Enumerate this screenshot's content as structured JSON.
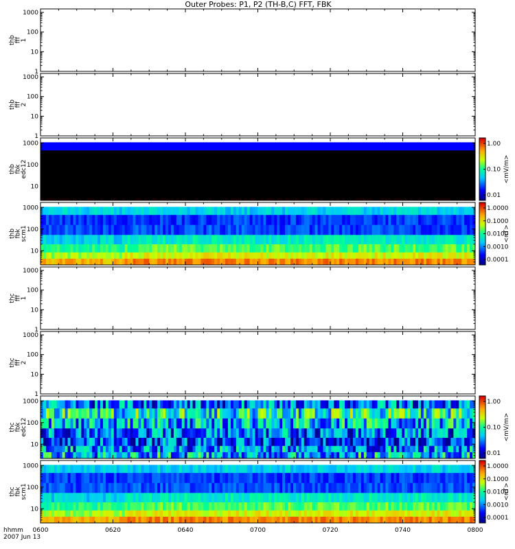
{
  "title": "Outer Probes: P1, P2 (TH-B,C) FFT, FBK",
  "x_axis": {
    "label_line1": "hhmm",
    "label_line2": "2007 Jun 13",
    "tick_labels": [
      "0600",
      "0620",
      "0640",
      "0700",
      "0720",
      "0740",
      "0800"
    ]
  },
  "chart_data": [
    {
      "type": "heatmap",
      "probe": "thb",
      "label_lines": [
        "thb",
        "fff",
        "1"
      ],
      "y_ticks": [
        "1000",
        "100",
        "10",
        "1"
      ],
      "empty": true
    },
    {
      "type": "heatmap",
      "probe": "thb",
      "label_lines": [
        "thb",
        "fff",
        "2"
      ],
      "y_ticks": [
        "1000",
        "100",
        "10",
        "1"
      ],
      "empty": true
    },
    {
      "type": "heatmap",
      "probe": "thb",
      "label_lines": [
        "thb",
        "fbk",
        "edc12"
      ],
      "y_ticks": [
        "1000",
        "100",
        "10"
      ],
      "empty": false,
      "pattern": "thb_edc",
      "colorbar": {
        "label": "<mV/m>",
        "ticks": [
          "1.00",
          "0.10",
          "0.01"
        ]
      }
    },
    {
      "type": "heatmap",
      "probe": "thb",
      "label_lines": [
        "thb",
        "fbk",
        "scm1"
      ],
      "y_ticks": [
        "1000",
        "100",
        "10"
      ],
      "empty": false,
      "pattern": "scm",
      "colorbar": {
        "label": "<nT>",
        "ticks": [
          "1.0000",
          "0.1000",
          "0.0100",
          "0.0010",
          "0.0001"
        ]
      }
    },
    {
      "type": "heatmap",
      "probe": "thc",
      "label_lines": [
        "thc",
        "fff",
        "1"
      ],
      "y_ticks": [
        "1000",
        "100",
        "10",
        "1"
      ],
      "empty": true
    },
    {
      "type": "heatmap",
      "probe": "thc",
      "label_lines": [
        "thc",
        "fff",
        "2"
      ],
      "y_ticks": [
        "1000",
        "100",
        "10",
        "1"
      ],
      "empty": true
    },
    {
      "type": "heatmap",
      "probe": "thc",
      "label_lines": [
        "thc",
        "fbk",
        "edc12"
      ],
      "y_ticks": [
        "1000",
        "100",
        "10"
      ],
      "empty": false,
      "pattern": "thc_edc",
      "colorbar": {
        "label": "<mV/m>",
        "ticks": [
          "1.00",
          "0.10",
          "0.01"
        ]
      }
    },
    {
      "type": "heatmap",
      "probe": "thc",
      "label_lines": [
        "thc",
        "fbk",
        "scm1"
      ],
      "y_ticks": [
        "1000",
        "100",
        "10"
      ],
      "empty": false,
      "pattern": "scm",
      "colorbar": {
        "label": "<nT>",
        "ticks": [
          "1.0000",
          "0.1000",
          "0.0100",
          "0.0010",
          "0.0001"
        ]
      }
    }
  ]
}
